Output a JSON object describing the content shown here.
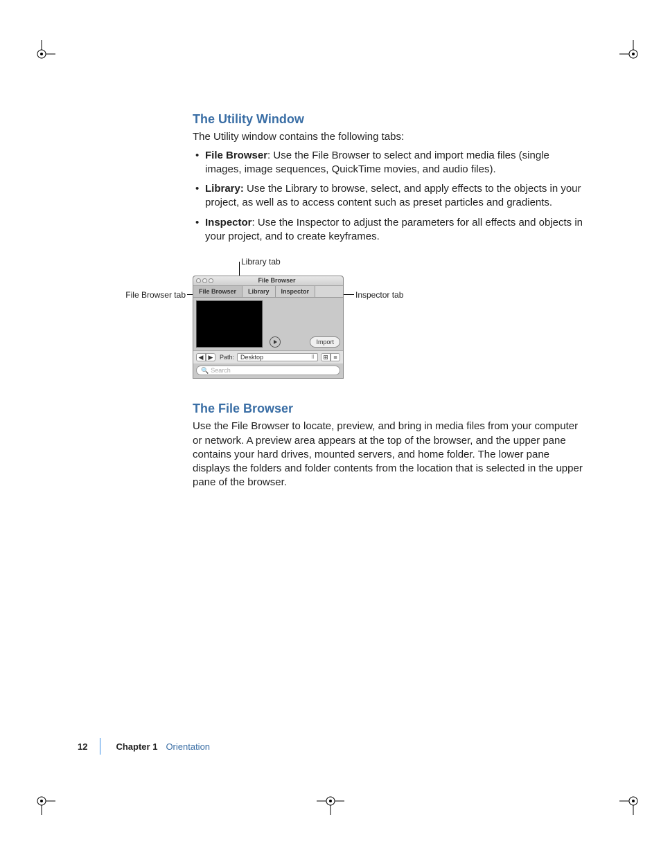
{
  "sections": {
    "utility": {
      "heading": "The Utility Window",
      "intro": "The Utility window contains the following tabs:",
      "bullets": [
        {
          "label": "File Browser",
          "sep": ":  ",
          "text": "Use the File Browser to select and import media files (single images, image sequences, QuickTime movies, and audio files)."
        },
        {
          "label": "Library:",
          "sep": "  ",
          "text": "Use the Library to browse, select, and apply effects to the objects in your project, as well as to access content such as preset particles and gradients."
        },
        {
          "label": "Inspector",
          "sep": ":   ",
          "text": "Use the Inspector to adjust the parameters for all effects and objects in your project, and to create keyframes."
        }
      ]
    },
    "filebrowser": {
      "heading": "The File Browser",
      "body": "Use the File Browser to locate, preview, and bring in media files from your computer or network. A preview area appears at the top of the browser, and the upper pane contains your hard drives, mounted servers, and home folder. The lower pane displays the folders and folder contents from the location that is selected in the upper pane of the browser."
    }
  },
  "figure": {
    "callouts": {
      "library_tab": "Library tab",
      "filebrowser_tab": "File Browser tab",
      "inspector_tab": "Inspector tab"
    },
    "window": {
      "title": "File Browser",
      "tabs": [
        "File Browser",
        "Library",
        "Inspector"
      ],
      "import_label": "Import",
      "path_label": "Path:",
      "path_value": "Desktop",
      "search_placeholder": "Search"
    }
  },
  "footer": {
    "page": "12",
    "chapter_label": "Chapter 1",
    "chapter_title": "Orientation"
  }
}
